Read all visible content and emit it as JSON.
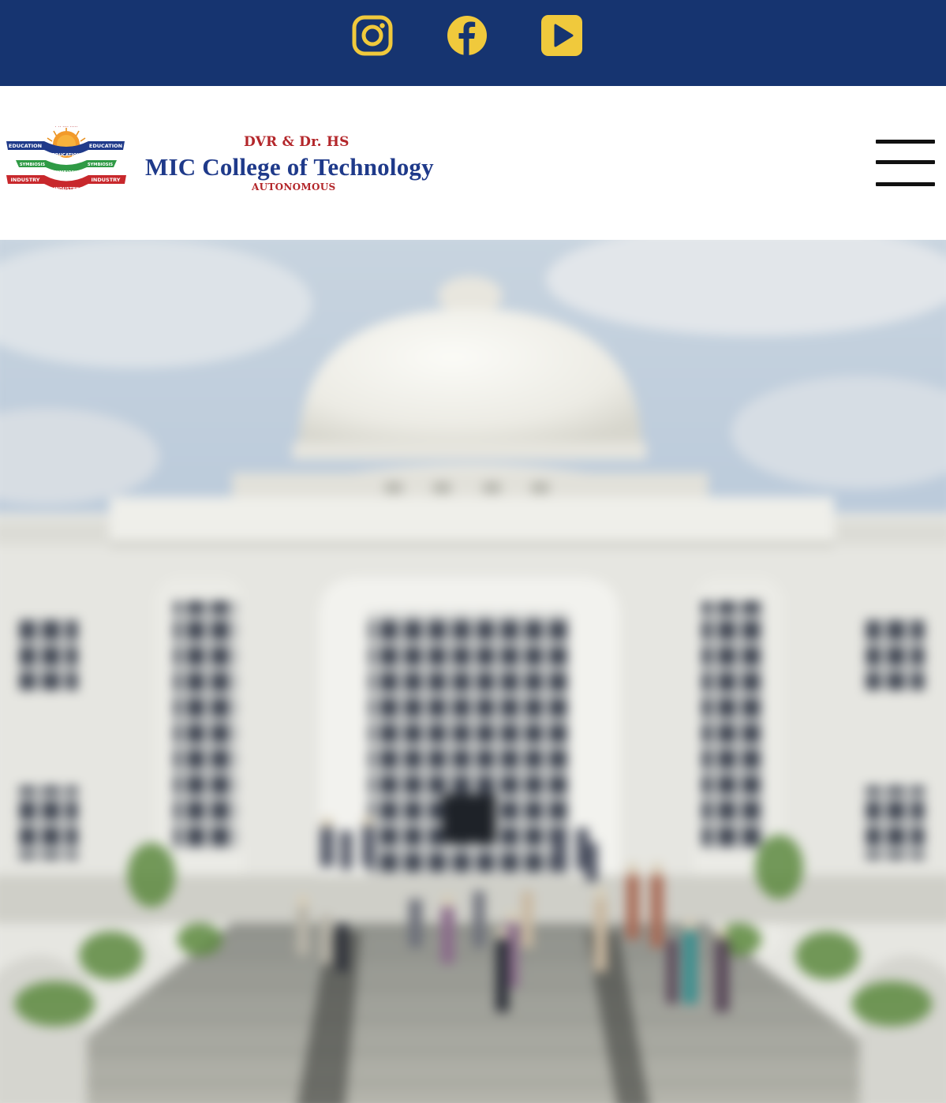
{
  "social": {
    "icons": [
      "instagram-icon",
      "facebook-icon",
      "youtube-icon"
    ],
    "bar_color": "#163470",
    "icon_color": "#f0c93c"
  },
  "header": {
    "prefix": "DVR & Dr. HS",
    "title": "MIC College of Technology",
    "subtitle": "AUTONOMOUS",
    "logo": {
      "text_top": "EDUCATION",
      "text_mid": "SYMBIOSIS",
      "text_bottom": "INDUSTRY"
    },
    "title_color": "#1f3a8a",
    "accent_color": "#b3262a"
  },
  "menu": {
    "icon": "hamburger-menu-icon"
  },
  "hero": {
    "image": "college-building-photo"
  }
}
